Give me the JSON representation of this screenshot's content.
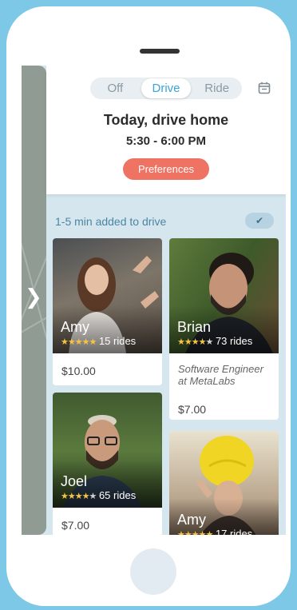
{
  "segmented": {
    "items": [
      "Off",
      "Drive",
      "Ride"
    ],
    "active": "Drive"
  },
  "header": {
    "title": "Today, drive home",
    "time": "5:30 - 6:00 PM",
    "preferences": "Preferences"
  },
  "status": {
    "text": "1-5 min added to drive",
    "check": "✔"
  },
  "map": {
    "chevron": "❯"
  },
  "cards": [
    {
      "name": "Amy",
      "stars": "★★★★★",
      "stars_off": "",
      "rides": "15 rides",
      "price": "$10.00",
      "job": ""
    },
    {
      "name": "Brian",
      "stars": "★★★★",
      "stars_off": "★",
      "rides": "73 rides",
      "price": "$7.00",
      "job": "Software Engineer at MetaLabs"
    },
    {
      "name": "Joel",
      "stars": "★★★★",
      "stars_off": "★",
      "rides": "65 rides",
      "price": "$7.00",
      "job": ""
    },
    {
      "name": "Amy",
      "stars": "★★★★★",
      "stars_off": "",
      "rides": "17 rides",
      "price": "",
      "job": ""
    }
  ],
  "colors": {
    "accent": "#3aa3d7",
    "button": "#ef7363",
    "star": "#f6c343",
    "background": "#7cc8e6"
  }
}
